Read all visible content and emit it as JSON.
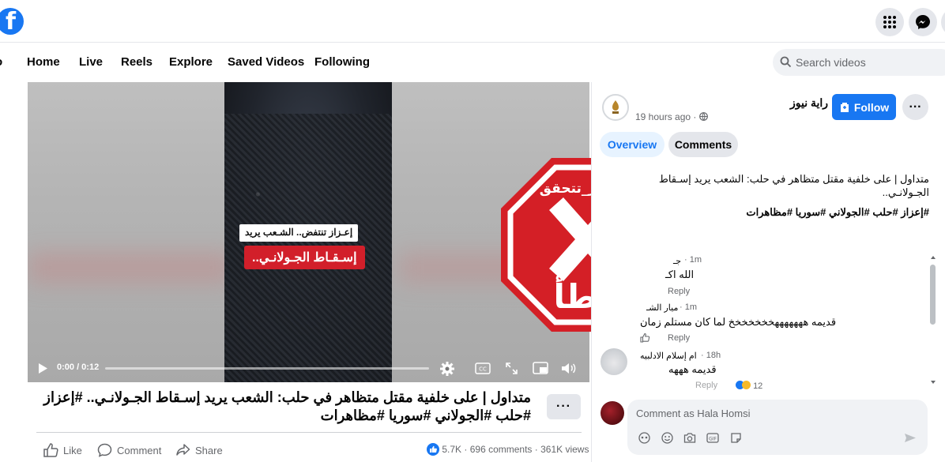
{
  "nav": {
    "items": [
      "Home",
      "Live",
      "Reels",
      "Explore",
      "Saved Videos",
      "Following"
    ],
    "search_placeholder": "Search videos"
  },
  "video": {
    "caption_white": "إعـزاز تنتفض.. الشـعب يريد",
    "caption_red": "إسـقـاط الجـولانـي..",
    "time": "0:00 / 0:12",
    "progress": 0.0
  },
  "stamp": {
    "hashtag": "#النهار_تتحقق",
    "verdict": "خطأ",
    "color": "#d41f26"
  },
  "post": {
    "title": "متداول | على خلفية مقتل متظاهر في حلب: الشعب يريد إسـقاط الجـولانـي.. #إعزاز #حلب #الجولاني #سوريا #مظاهرات",
    "like": "Like",
    "comment": "Comment",
    "share": "Share",
    "reactions": "5.7K",
    "comments": "696 comments",
    "views": "361K views"
  },
  "page": {
    "name": "راية نيوز",
    "time": "19 hours ago",
    "follow": "Follow",
    "tabs": [
      "Overview",
      "Comments"
    ],
    "description": "متداول | على خلفية مقتل متظاهر في حلب: الشعب يريد إسـقاط الجـولانـي..",
    "hashtags": "#إعزاز #حلب #الجولاني #سوريا #مظاهرات"
  },
  "comments": [
    {
      "name": "جـ",
      "time": "1m",
      "text": "الله اكـ",
      "reply": "Reply"
    },
    {
      "name": "ميار الشـ",
      "time": "1m",
      "text": "قديمه هههههههخخخخخخخ لما كان مستلم زمان",
      "reply": "Reply"
    },
    {
      "name": "ام إسلام الادلبيه",
      "time": "18h",
      "text": "قديمه هههه",
      "reply": "Reply",
      "reactions": "12"
    }
  ],
  "composer": {
    "placeholder": "Comment as Hala Homsi"
  },
  "colors": {
    "brand": "#1877f2",
    "red": "#d21f2a"
  }
}
